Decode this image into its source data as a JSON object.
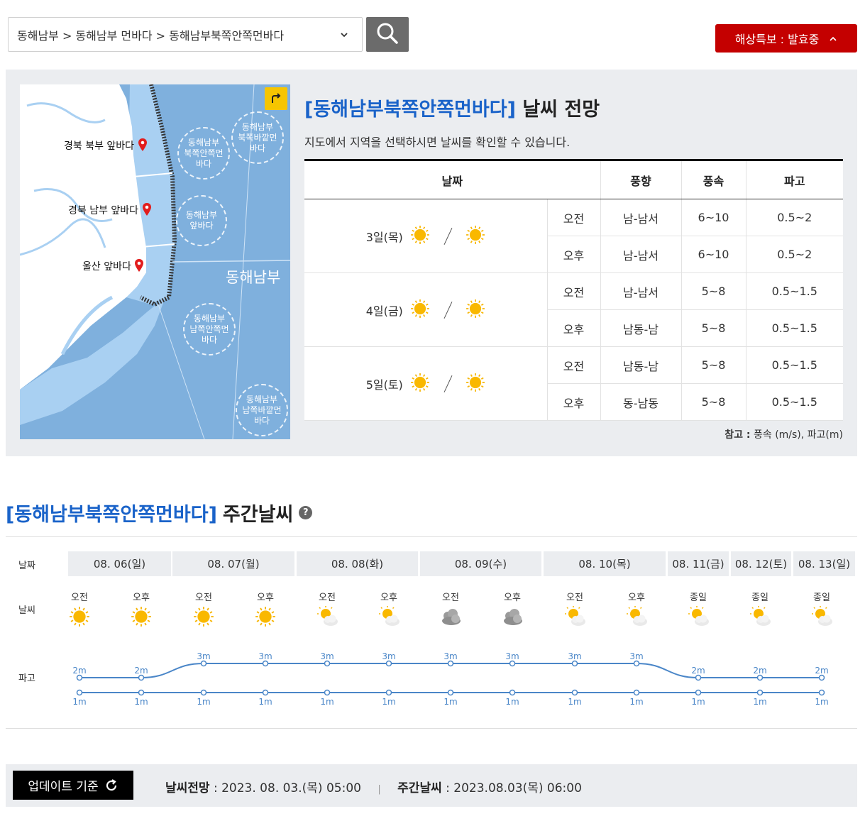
{
  "header": {
    "breadcrumb": "동해남부 > 동해남부 먼바다 > 동해남부북쪽안쪽먼바다",
    "alert_label": "해상특보 : 발효중",
    "icons": {
      "dropdown": "chevron-down-icon",
      "search": "search-icon",
      "alert_toggle": "chevron-up-icon"
    }
  },
  "map": {
    "markers": [
      "경북 북부 앞바다",
      "경북 남부 앞바다",
      "울산 앞바다"
    ],
    "zones": [
      "동해남부\n북쪽안쪽먼\n바다",
      "동해남부\n북쪽바깥먼\n바다",
      "동해남부\n앞바다",
      "동해남부\n남쪽안쪽먼\n바다",
      "동해남부\n남쪽바깥먼\n바다"
    ],
    "region_label": "동해남부",
    "colors": {
      "sea": "#7fb0dd",
      "coast_sea": "#a9d0f2",
      "land": "#ffffff",
      "button": "#f6c500"
    }
  },
  "forecast": {
    "title_area": "[동해남부북쪽안쪽먼바다]",
    "title_suffix": "날씨 전망",
    "subtitle": "지도에서 지역을 선택하시면 날씨를 확인할 수 있습니다.",
    "headers": [
      "날짜",
      "풍향",
      "풍속",
      "파고"
    ],
    "days": [
      {
        "date": "3일(목)",
        "icons": [
          "sun-icon",
          "sun-icon"
        ],
        "rows": [
          {
            "period": "오전",
            "wind_dir": "남-남서",
            "wind_speed": "6~10",
            "wave": "0.5~2"
          },
          {
            "period": "오후",
            "wind_dir": "남-남서",
            "wind_speed": "6~10",
            "wave": "0.5~2"
          }
        ]
      },
      {
        "date": "4일(금)",
        "icons": [
          "sun-icon",
          "sun-icon"
        ],
        "rows": [
          {
            "period": "오전",
            "wind_dir": "남-남서",
            "wind_speed": "5~8",
            "wave": "0.5~1.5"
          },
          {
            "period": "오후",
            "wind_dir": "남동-남",
            "wind_speed": "5~8",
            "wave": "0.5~1.5"
          }
        ]
      },
      {
        "date": "5일(토)",
        "icons": [
          "sun-icon",
          "sun-icon"
        ],
        "rows": [
          {
            "period": "오전",
            "wind_dir": "남동-남",
            "wind_speed": "5~8",
            "wave": "0.5~1.5"
          },
          {
            "period": "오후",
            "wind_dir": "동-남동",
            "wind_speed": "5~8",
            "wave": "0.5~1.5"
          }
        ]
      }
    ],
    "note_label": "참고 :",
    "note_text": "풍속 (m/s), 파고(m)"
  },
  "weekly": {
    "title_area": "[동해남부북쪽안쪽먼바다]",
    "title_suffix": "주간날씨",
    "help": "?",
    "row_labels": {
      "date": "날짜",
      "weather": "날씨",
      "wave": "파고"
    },
    "dates": [
      "08. 06(일)",
      "08. 07(월)",
      "08. 08(화)",
      "08. 09(수)",
      "08. 10(목)",
      "08. 11(금)",
      "08. 12(토)",
      "08. 13(일)"
    ],
    "slots": [
      {
        "period": "오전",
        "icon": "sun-icon",
        "wave_max": "2m",
        "wave_min": "1m"
      },
      {
        "period": "오후",
        "icon": "sun-icon",
        "wave_max": "2m",
        "wave_min": "1m"
      },
      {
        "period": "오전",
        "icon": "sun-icon",
        "wave_max": "3m",
        "wave_min": "1m"
      },
      {
        "period": "오후",
        "icon": "sun-icon",
        "wave_max": "3m",
        "wave_min": "1m"
      },
      {
        "period": "오전",
        "icon": "partly-cloudy-icon",
        "wave_max": "3m",
        "wave_min": "1m"
      },
      {
        "period": "오후",
        "icon": "partly-cloudy-icon",
        "wave_max": "3m",
        "wave_min": "1m"
      },
      {
        "period": "오전",
        "icon": "cloudy-icon",
        "wave_max": "3m",
        "wave_min": "1m"
      },
      {
        "period": "오후",
        "icon": "cloudy-icon",
        "wave_max": "3m",
        "wave_min": "1m"
      },
      {
        "period": "오전",
        "icon": "partly-cloudy-icon",
        "wave_max": "3m",
        "wave_min": "1m"
      },
      {
        "period": "오후",
        "icon": "partly-cloudy-icon",
        "wave_max": "3m",
        "wave_min": "1m"
      },
      {
        "period": "종일",
        "icon": "partly-cloudy-icon",
        "wave_max": "2m",
        "wave_min": "1m"
      },
      {
        "period": "종일",
        "icon": "partly-cloudy-icon",
        "wave_max": "2m",
        "wave_min": "1m"
      },
      {
        "period": "종일",
        "icon": "partly-cloudy-icon",
        "wave_max": "2m",
        "wave_min": "1m"
      }
    ],
    "line_color": "#4a86c8"
  },
  "footer": {
    "update_label": "업데이트 기준",
    "forecast_label": "날씨전망",
    "forecast_time": "2023. 08. 03.(목) 05:00",
    "weekly_label": "주간날씨",
    "weekly_time": "2023.08.03(목) 06:00",
    "separator": "|"
  }
}
